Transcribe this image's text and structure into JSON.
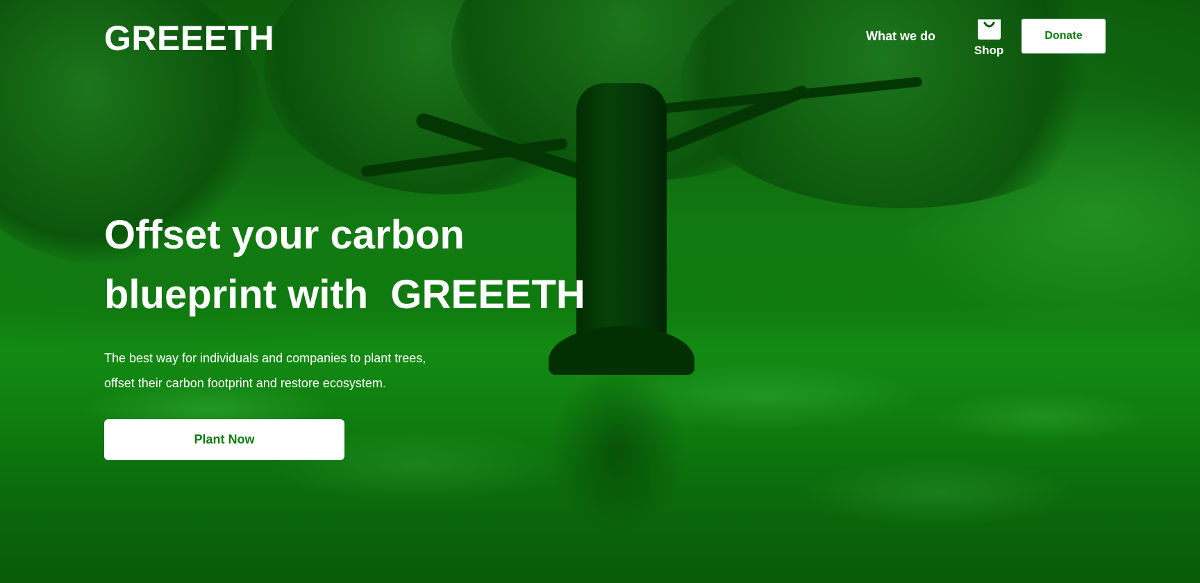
{
  "brand": {
    "logo_text": "GREEETH"
  },
  "nav": {
    "what_we_do_label": "What we do",
    "shop_label": "Shop",
    "shop_icon": "shopping-bag-icon",
    "donate_label": "Donate"
  },
  "hero": {
    "headline_line1": "Offset your carbon",
    "headline_line2": "blueprint with  GREEETH",
    "subcopy_line1": "The best way for individuals and companies to plant trees,",
    "subcopy_line2": "offset their carbon footprint and restore ecosystem.",
    "cta_label": "Plant Now"
  },
  "colors": {
    "background_tint": "#0a5c0a",
    "button_background": "#ffffff",
    "button_text": "#0e7a0e",
    "text": "#ffffff"
  }
}
